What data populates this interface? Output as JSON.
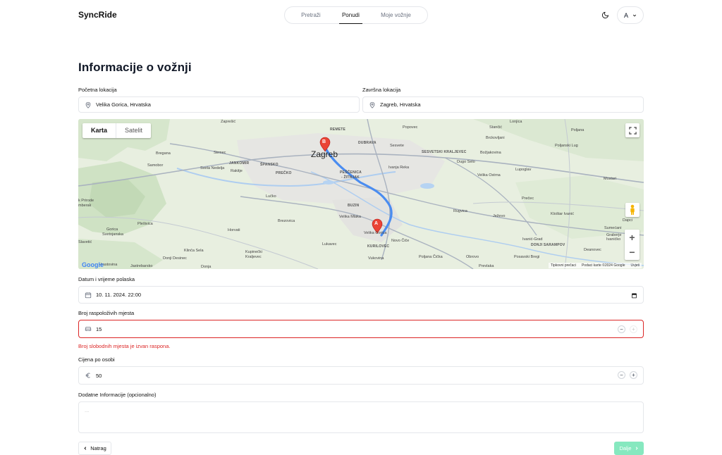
{
  "header": {
    "logo": "SyncRide",
    "tabs": [
      {
        "label": "Pretraži"
      },
      {
        "label": "Ponudi"
      },
      {
        "label": "Moje vožnje"
      }
    ],
    "avatar_initial": "A"
  },
  "page": {
    "title": "Informacije o vožnji"
  },
  "start": {
    "label": "Početna lokacija",
    "value": "Velika Gorica, Hrvatska"
  },
  "end": {
    "label": "Završna lokacija",
    "value": "Zagreb, Hrvatska"
  },
  "map": {
    "toggle_map": "Karta",
    "toggle_satellite": "Satelit",
    "marker_a": "A",
    "marker_b": "B",
    "google": "Google",
    "attrib_shortcuts": "Tipkovni prečaci",
    "attrib_data": "Podaci karte ©2024 Google",
    "attrib_terms": "Uvjeti",
    "route_color": "#4a8cf0",
    "marker_color": "#ea4335",
    "places": {
      "zagreb": "Zagreb",
      "velika_gorica": "Velika Gorica",
      "pescenica": "PEŠČENICA",
      "zitnjak": "- ŽITNJAK",
      "samobor": "Samobor",
      "sveta_nedelja": "Sveta Nedelja",
      "strmec": "Strmec",
      "rakitje": "Rakitje",
      "lucko": "Lučko",
      "brezovica": "Brezovica",
      "horvati": "Horvati",
      "plesivica": "Plešivica",
      "gorica": "Gorica",
      "svetojanska": "Svetojanska",
      "slavetic": "Slavetić",
      "klinca_sela": "Klinča Sela",
      "donji_desinec": "Donji Desinec",
      "jastrebarsko": "Jastrebarsko",
      "donja": "Donja",
      "kupinecki": "Kupinečki",
      "kraljevec": "Kraljevec",
      "lukavec": "Lukavec",
      "kurilovec": "KURILOVEC",
      "vukovina": "Vukovina",
      "novo_cice": "Novo Čiče",
      "poljana_cicka": "Poljana Čička",
      "obrovo": "Obrovo",
      "prevlaka": "Prevlaka",
      "posavski_bregi": "Posavski Bregi",
      "rugvica": "Rugvica",
      "jezevo": "Ježevo",
      "precec": "Prečec",
      "klostar_ivanic": "Kloštar Ivanić",
      "dapci": "Dapci",
      "sumecani": "Sumećani",
      "graberje": "Graberje",
      "ivanicko": "Ivanićko",
      "ivanic_grad": "Ivanić-Grad",
      "donji_sarampov": "DONJI SARAMPOV",
      "deanovec": "Deanovec",
      "lupoglav": "Lupoglav",
      "velika_ostrna": "Velika Ostrna",
      "dugo_selo": "Dugo Selo",
      "bozjakovina": "Božjakovina",
      "brckovljani": "Brckovljani",
      "stancic": "Stančić",
      "lonjica": "Lonjica",
      "poljana": "Poljana",
      "poljanski_lug": "Poljanski Lug",
      "mostari": "Mostari",
      "popovec": "Popovec",
      "sesvete": "Sesvete",
      "sesvetski_kraljevec": "SESVETSKI KRALJEVEC",
      "ivanja_reka": "Ivanja Reka",
      "remete": "REMETE",
      "dubrava": "DUBRAVA",
      "zapresic": "Zaprešić",
      "jankomir": "JANKOMIR",
      "spansko": "ŠPANSKO",
      "precko": "PREČKO",
      "buzin": "BUZIN",
      "velika_mlaka": "Velika Mlaka",
      "bregana": "Bregana",
      "park_prirode": "k Prirode",
      "umberak": "mberak",
      "hrastovina": "Hrastovina"
    }
  },
  "datetime": {
    "label": "Datum i vrijeme polaska",
    "value": "10. 11. 2024.  22:00"
  },
  "seats": {
    "label": "Broj raspoloživih mjesta",
    "value": "15",
    "error": "Broj slobodnih mjesta je izvan raspona."
  },
  "price": {
    "label": "Cijena po osobi",
    "value": "50"
  },
  "notes": {
    "label": "Dodatne Informacije (opcionalno)",
    "placeholder": "..."
  },
  "buttons": {
    "back": "Natrag",
    "next": "Dalje"
  }
}
